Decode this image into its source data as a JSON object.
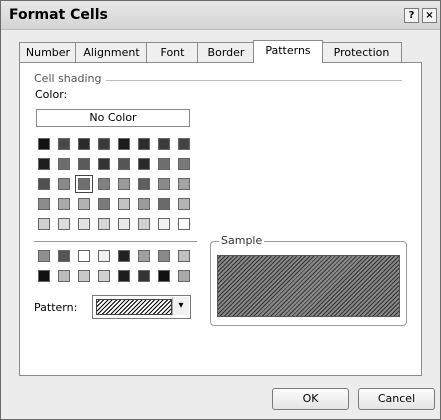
{
  "window": {
    "title": "Format Cells",
    "help_glyph": "?",
    "close_glyph": "×"
  },
  "tabs": [
    {
      "label": "Number"
    },
    {
      "label": "Alignment"
    },
    {
      "label": "Font"
    },
    {
      "label": "Border"
    },
    {
      "label": "Patterns",
      "active": true
    },
    {
      "label": "Protection"
    }
  ],
  "shading": {
    "group_title": "Cell shading",
    "color_label": "Color:",
    "no_color": "No Color",
    "palette_rows": [
      [
        "#111111",
        "#4a4a4a",
        "#2b2b2b",
        "#3a3a3a",
        "#1a1a1a",
        "#2c2c2c",
        "#3b3b3b",
        "#444444"
      ],
      [
        "#1e1e1e",
        "#6d6d6d",
        "#5a5a5a",
        "#333333",
        "#555555",
        "#2a2a2a",
        "#6e6e6e",
        "#7a7a7a"
      ],
      [
        "#4f4f4f",
        "#8a8a8a",
        "#6f6f6f",
        "#7f7f7f",
        "#9a9a9a",
        "#5e5e5e",
        "#8b8b8b",
        "#a3a3a3"
      ],
      [
        "#8c8c8c",
        "#aaaaaa",
        "#b2b2b2",
        "#7b7b7b",
        "#c3c3c3",
        "#9c9c9c",
        "#6a6a6a",
        "#b5b5b5"
      ],
      [
        "#cfcfcf",
        "#dddddd",
        "#e3e3e3",
        "#d5d5d5",
        "#e8e8e8",
        "#d2d2d2",
        "#f0f0f0",
        "#ffffff"
      ]
    ],
    "extra_rows": [
      [
        "#8f8f8f",
        "#555555",
        "#ffffff",
        "#f0f0f0",
        "#222222",
        "#a0a0a0",
        "#8a8a8a",
        "#c0c0c0"
      ],
      [
        "#111111",
        "#bbbbbb",
        "#c8c8c8",
        "#d0d0d0",
        "#1b1b1b",
        "#333333",
        "#111111",
        "#aaaaaa"
      ]
    ],
    "selected": {
      "row": 2,
      "col": 2
    }
  },
  "pattern": {
    "label": "Pattern:",
    "dropdown_glyph": "▾"
  },
  "sample": {
    "label": "Sample"
  },
  "buttons": {
    "ok": "OK",
    "cancel": "Cancel"
  }
}
